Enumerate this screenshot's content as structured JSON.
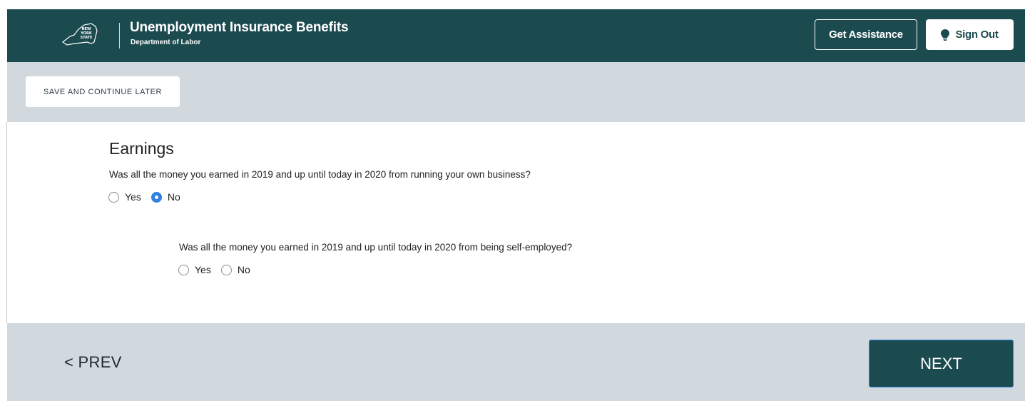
{
  "header": {
    "logo_alt": "NEW YORK STATE",
    "title": "Unemployment Insurance Benefits",
    "subtitle": "Department of Labor",
    "get_assistance_label": "Get Assistance",
    "sign_out_label": "Sign Out"
  },
  "toolbar": {
    "save_label": "SAVE AND CONTINUE LATER"
  },
  "form": {
    "section_title": "Earnings",
    "q1": {
      "text": "Was all the money you earned in 2019 and up until today in 2020 from running your own business?",
      "options": [
        {
          "label": "Yes",
          "checked": false
        },
        {
          "label": "No",
          "checked": true
        }
      ]
    },
    "q2": {
      "text": "Was all the money you earned in 2019 and up until today in 2020 from being self-employed?",
      "options": [
        {
          "label": "Yes",
          "checked": false
        },
        {
          "label": "No",
          "checked": false
        }
      ]
    }
  },
  "footer": {
    "prev_label": "<  PREV",
    "next_label": "NEXT"
  },
  "colors": {
    "header_bg": "#1b4a4f",
    "toolbar_bg": "#d1d9de",
    "radio_checked": "#2f80e1"
  }
}
